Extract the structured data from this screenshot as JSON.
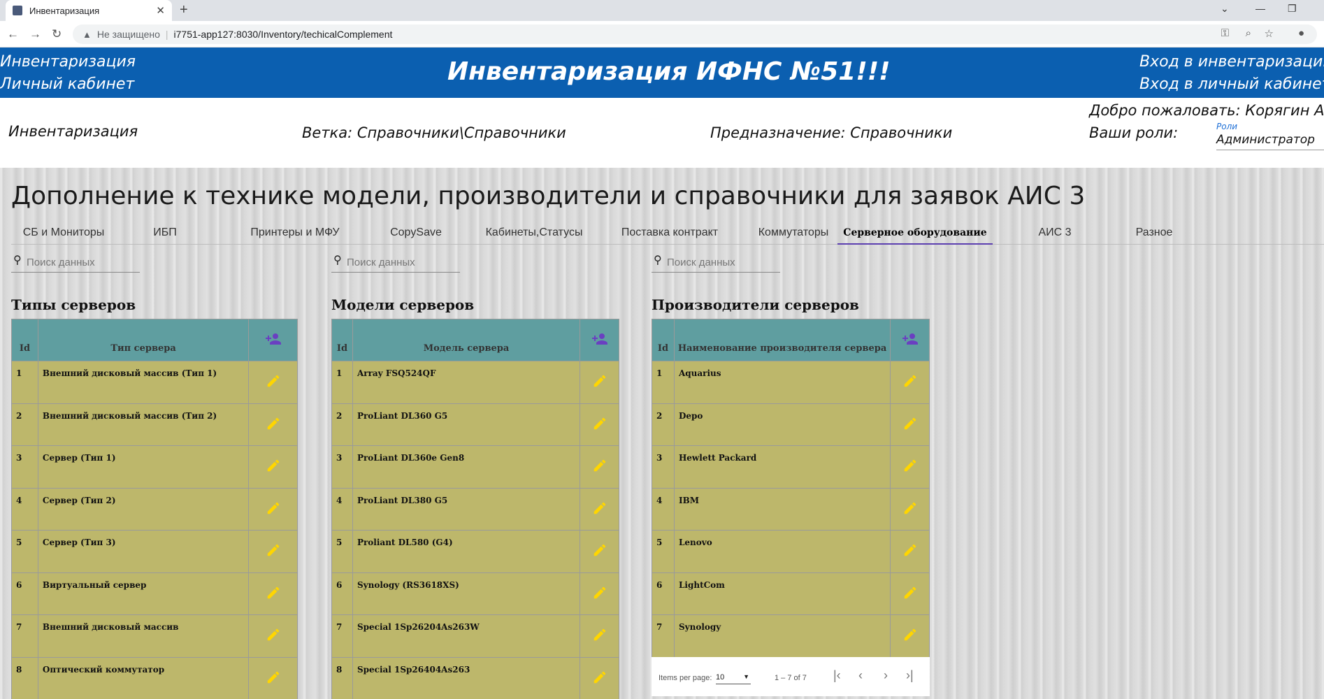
{
  "browser": {
    "tab_title": "Инвентаризация",
    "insecure_label": "Не защищено",
    "url": "i7751-app127:8030/Inventory/techicalComplement"
  },
  "header": {
    "left_links": [
      "Инвентаризация",
      "Личный кабинет"
    ],
    "title": "Инвентаризация ИФНС №51!!!",
    "right_links": [
      "Вход в инвентаризацию",
      "Вход в личный кабинет"
    ]
  },
  "info": {
    "section": "Инвентаризация",
    "branch": "Ветка: Справочники\\Справочники",
    "purpose": "Предназначение: Справочники",
    "welcome": "Добро пожаловать: Корягин А.С.",
    "roles_label": "Ваши роли:",
    "roles_field_label": "Роли",
    "roles_value": "Администратор"
  },
  "page": {
    "title": "Дополнение к технике модели, производители и справочники для заявок АИС 3",
    "tabs": [
      "СБ и Мониторы",
      "ИБП",
      "Принтеры и МФУ",
      "CopySave",
      "Кабинеты,Статусы",
      "Поставка контракт",
      "Коммутаторы",
      "Серверное оборудование",
      "АИС 3",
      "Разное"
    ],
    "active_tab": "Серверное оборудование",
    "search_placeholder": "Поиск данных"
  },
  "tables": {
    "types": {
      "title": "Типы серверов",
      "col_id": "Id",
      "col_name": "Тип сервера",
      "rows": [
        {
          "id": "1",
          "name": "Внешний дисковый массив (Тип 1)"
        },
        {
          "id": "2",
          "name": "Внешний дисковый массив (Тип 2)"
        },
        {
          "id": "3",
          "name": "Сервер (Тип 1)"
        },
        {
          "id": "4",
          "name": "Сервер (Тип 2)"
        },
        {
          "id": "5",
          "name": "Сервер (Тип 3)"
        },
        {
          "id": "6",
          "name": "Виртуальный сервер"
        },
        {
          "id": "7",
          "name": "Внешний дисковый массив"
        },
        {
          "id": "8",
          "name": "Оптический коммутатор"
        }
      ]
    },
    "models": {
      "title": "Модели серверов",
      "col_id": "Id",
      "col_name": "Модель сервера",
      "rows": [
        {
          "id": "1",
          "name": "Array FSQ524QF"
        },
        {
          "id": "2",
          "name": "ProLiant DL360 G5"
        },
        {
          "id": "3",
          "name": "ProLiant DL360e Gen8"
        },
        {
          "id": "4",
          "name": "ProLiant DL380 G5"
        },
        {
          "id": "5",
          "name": "Proliant DL580 (G4)"
        },
        {
          "id": "6",
          "name": "Synology (RS3618XS)"
        },
        {
          "id": "7",
          "name": "Special 1Sp26204As263W"
        },
        {
          "id": "8",
          "name": "Special 1Sp26404As263"
        }
      ]
    },
    "makers": {
      "title": "Производители серверов",
      "col_id": "Id",
      "col_name": "Наименование производителя сервера",
      "rows": [
        {
          "id": "1",
          "name": "Aquarius"
        },
        {
          "id": "2",
          "name": "Depo"
        },
        {
          "id": "3",
          "name": "Hewlett Packard"
        },
        {
          "id": "4",
          "name": "IBM"
        },
        {
          "id": "5",
          "name": "Lenovo"
        },
        {
          "id": "6",
          "name": "LightCom"
        },
        {
          "id": "7",
          "name": "Synology"
        }
      ]
    }
  },
  "paginator": {
    "items_label": "Items per page:",
    "page_size": "10",
    "range": "1 – 7 of 7"
  },
  "colors": {
    "header_blue": "#0b5fb0",
    "table_header": "#5f9ea0",
    "table_row": "#bdb76b",
    "pencil": "#ffd600",
    "add_icon": "#6a3fc1"
  }
}
